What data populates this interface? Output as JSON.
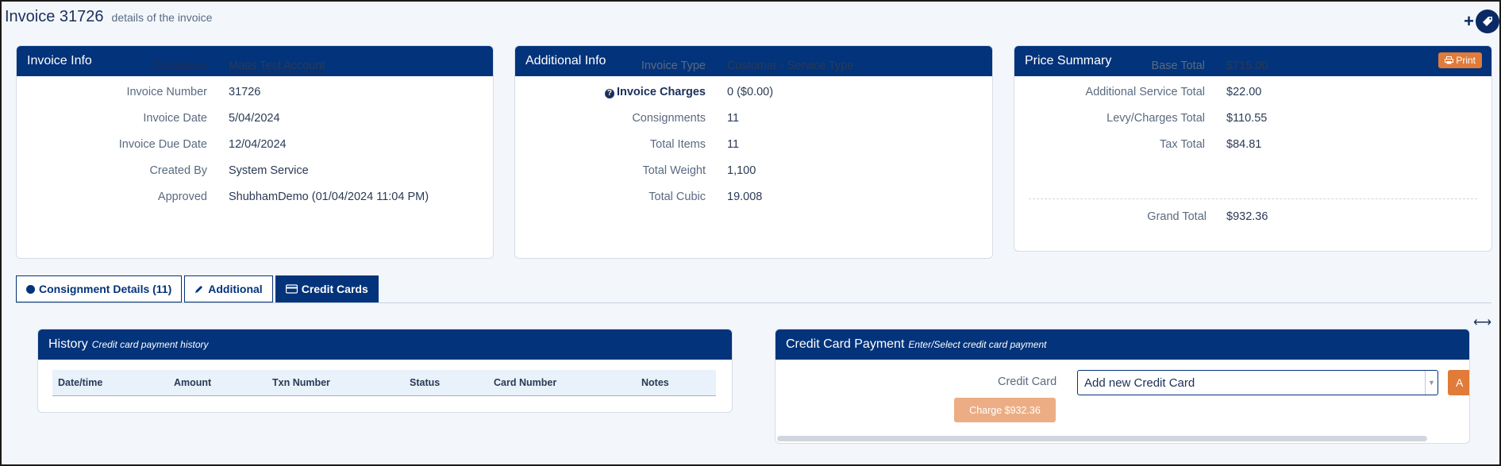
{
  "header": {
    "title": "Invoice 31726",
    "subtitle": "details of the invoice"
  },
  "invoice_info": {
    "title": "Invoice Info",
    "rows": [
      {
        "label": "Customer",
        "value": "Matts Test Account"
      },
      {
        "label": "Invoice Number",
        "value": "31726"
      },
      {
        "label": "Invoice Date",
        "value": "5/04/2024"
      },
      {
        "label": "Invoice Due Date",
        "value": "12/04/2024"
      },
      {
        "label": "Created By",
        "value": "System Service"
      },
      {
        "label": "Approved",
        "value": "ShubhamDemo (01/04/2024 11:04 PM)"
      }
    ]
  },
  "additional_info": {
    "title": "Additional Info",
    "rows": [
      {
        "label": "Invoice Type",
        "value": "Customer - Service Type"
      },
      {
        "label": "Invoice Charges",
        "value": "0 ($0.00)"
      },
      {
        "label": "Consignments",
        "value": "11"
      },
      {
        "label": "Total Items",
        "value": "11"
      },
      {
        "label": "Total Weight",
        "value": "1,100"
      },
      {
        "label": "Total Cubic",
        "value": "19.008"
      }
    ]
  },
  "price_summary": {
    "title": "Price Summary",
    "print_label": "Print",
    "rows": [
      {
        "label": "Base Total",
        "value": "$715.00"
      },
      {
        "label": "Additional Service Total",
        "value": "$22.00"
      },
      {
        "label": "Levy/Charges Total",
        "value": "$110.55"
      },
      {
        "label": "Tax Total",
        "value": "$84.81"
      }
    ],
    "grand_total_label": "Grand Total",
    "grand_total_value": "$932.36"
  },
  "tabs": [
    {
      "label": "Consignment Details (11)",
      "icon": "circle-icon",
      "active": false
    },
    {
      "label": "Additional",
      "icon": "pencil-icon",
      "active": false
    },
    {
      "label": "Credit Cards",
      "icon": "credit-card-icon",
      "active": true
    }
  ],
  "history": {
    "title": "History",
    "subtitle": "Credit card payment history",
    "columns": [
      "Date/time",
      "Amount",
      "Txn Number",
      "Status",
      "Card Number",
      "Notes"
    ]
  },
  "payment": {
    "title": "Credit Card Payment",
    "subtitle": "Enter/Select credit card payment",
    "card_label": "Credit Card",
    "card_selected": "Add new Credit Card",
    "add_label": "A",
    "charge_label": "Charge $932.36"
  },
  "colors": {
    "primary": "#03337a",
    "accent": "#e07b3a",
    "background": "#f3f7fc"
  }
}
